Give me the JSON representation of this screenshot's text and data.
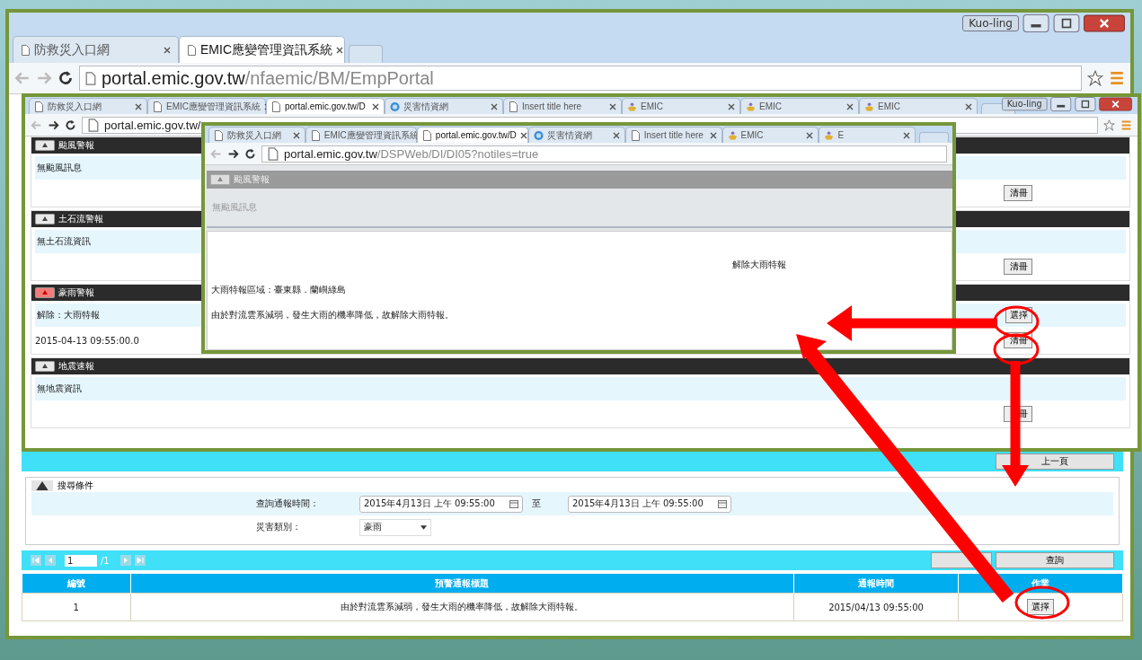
{
  "outer_window": {
    "user": "Kuo-ling",
    "tabs": [
      {
        "label": "防救災入口網",
        "kind": "page",
        "selected": false
      },
      {
        "label": "EMIC應變管理資訊系統",
        "kind": "page",
        "selected": true
      }
    ],
    "url_host": "portal.emic.gov.tw",
    "url_path": "/nfaemic/BM/EmpPortal",
    "query_panel": {
      "back_button": "上一頁",
      "legend": "搜尋條件",
      "time_label": "查詢通報時間：",
      "time_from": "2015年4月13日 上午 09:55:00",
      "to_label": "至",
      "time_to": "2015年4月13日 上午 09:55:00",
      "type_label": "災害類別：",
      "type_value": "豪雨",
      "page": "1",
      "page_total": "/1",
      "search_button": "查詢",
      "columns": [
        "編號",
        "預警通報標題",
        "通報時間",
        "作業"
      ],
      "rows": [
        {
          "no": "1",
          "title": "由於對流雲系減弱，發生大雨的機率降低，故解除大雨特報。",
          "time": "2015/04/13 09:55:00",
          "action": "選擇"
        }
      ]
    }
  },
  "middle_window": {
    "user": "Kuo-ling",
    "tabs": [
      {
        "label": "防救災入口網",
        "kind": "page",
        "selected": false
      },
      {
        "label": "EMIC應變管理資訊系統",
        "kind": "page",
        "selected": false
      },
      {
        "label": "portal.emic.gov.tw/D",
        "kind": "page",
        "selected": true
      },
      {
        "label": "災害情資網",
        "kind": "globe",
        "selected": false
      },
      {
        "label": "Insert title here",
        "kind": "page",
        "selected": false
      },
      {
        "label": "EMIC",
        "kind": "logo",
        "selected": false
      },
      {
        "label": "EMIC",
        "kind": "logo",
        "selected": false
      },
      {
        "label": "EMIC",
        "kind": "logo",
        "selected": false
      }
    ],
    "url_host": "portal.emic.gov.tw/",
    "sections": [
      {
        "title": "颱風警報",
        "alert": false,
        "message": "無颱風訊息",
        "clear_button": "清冊"
      },
      {
        "title": "土石流警報",
        "alert": false,
        "message": "無土石流資訊",
        "clear_button": "清冊"
      },
      {
        "title": "豪雨警報",
        "alert": true,
        "message": "解除：大雨特報",
        "select_button": "選擇",
        "date": "2015-04-13 09:55:00.0",
        "clear_button": "清冊"
      },
      {
        "title": "地震速報",
        "alert": false,
        "message": "無地震資訊",
        "clear_button": "冊"
      }
    ]
  },
  "inner_window": {
    "tabs": [
      {
        "label": "防救災入口網",
        "kind": "page",
        "selected": false
      },
      {
        "label": "EMIC應變管理資訊系統",
        "kind": "page",
        "selected": false
      },
      {
        "label": "portal.emic.gov.tw/D",
        "kind": "page",
        "selected": true
      },
      {
        "label": "災害情資網",
        "kind": "globe",
        "selected": false
      },
      {
        "label": "Insert title here",
        "kind": "page",
        "selected": false
      },
      {
        "label": "EMIC",
        "kind": "logo",
        "selected": false
      },
      {
        "label": "E",
        "kind": "logo",
        "selected": false
      }
    ],
    "url_host": "portal.emic.gov.tw",
    "url_path": "/DSPWeb/DI/DI05?notiles=true",
    "header": "颱風警報",
    "header_message": "無颱風訊息",
    "detail_title": "解除大雨特報",
    "area": "大雨特報區域：臺東縣．蘭嶼綠島",
    "description": "由於對流雲系減弱，發生大雨的機率降低，故解除大雨特報。"
  }
}
